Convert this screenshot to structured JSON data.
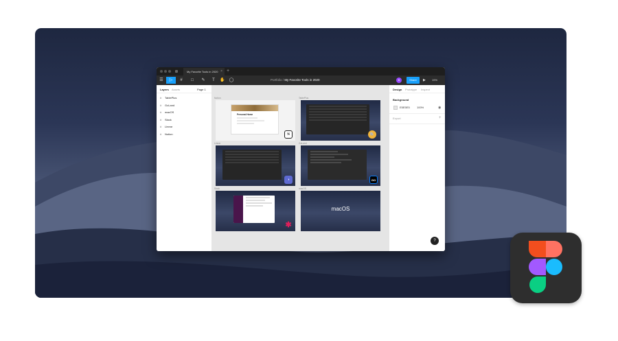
{
  "window": {
    "tab_title": "My Favorite Tools in 2020",
    "tab_close": "×",
    "new_tab": "+"
  },
  "toolbar": {
    "menu_icon": "☰",
    "move_tool": "▷",
    "frame_tool": "#",
    "shape_tool": "□",
    "pen_tool": "✎",
    "text_tool": "T",
    "hand_tool": "✋",
    "comment_tool": "◯",
    "breadcrumb_project": "Portfolio",
    "breadcrumb_separator": "/",
    "breadcrumb_file": "My Favorite Tools in 2020",
    "avatar_initial": "B",
    "share_label": "Share",
    "play_icon": "▶",
    "zoom_label": "19%"
  },
  "left_panel": {
    "tabs": [
      "Layers",
      "Assets"
    ],
    "page_label": "Page 1",
    "layers": [
      "TablePlus",
      "GoLand",
      "macOS",
      "Slack",
      "Linear",
      "Notion"
    ]
  },
  "canvas": {
    "frames": [
      {
        "label": "Notion",
        "badge": "N",
        "badge_color": "#ffffff"
      },
      {
        "label": "TablePlus",
        "badge": "🐘",
        "badge_color": "#f0b43c"
      },
      {
        "label": "Linear",
        "badge": "◑",
        "badge_color": "#5e6ad2"
      },
      {
        "label": "GoLand",
        "badge": "GO",
        "badge_color": "#087cfa"
      },
      {
        "label": "Slack",
        "badge": "✱",
        "badge_color": "#ffffff"
      },
      {
        "label": "macOS",
        "badge": "",
        "badge_color": ""
      }
    ],
    "macos_text": "macOS",
    "notion_page_title": "Personal Home"
  },
  "right_panel": {
    "tabs": [
      "Design",
      "Prototype",
      "Inspect"
    ],
    "background_label": "Background",
    "bg_hex": "E5E5E5",
    "bg_opacity": "100%",
    "eye_icon": "◉",
    "export_label": "Export",
    "add_icon": "+"
  },
  "help_label": "?",
  "colors": {
    "accent": "#18a0fb",
    "figma_red": "#f24e1e",
    "figma_orange": "#ff7262",
    "figma_purple": "#a259ff",
    "figma_blue": "#1abcfe",
    "figma_green": "#0acf83"
  }
}
